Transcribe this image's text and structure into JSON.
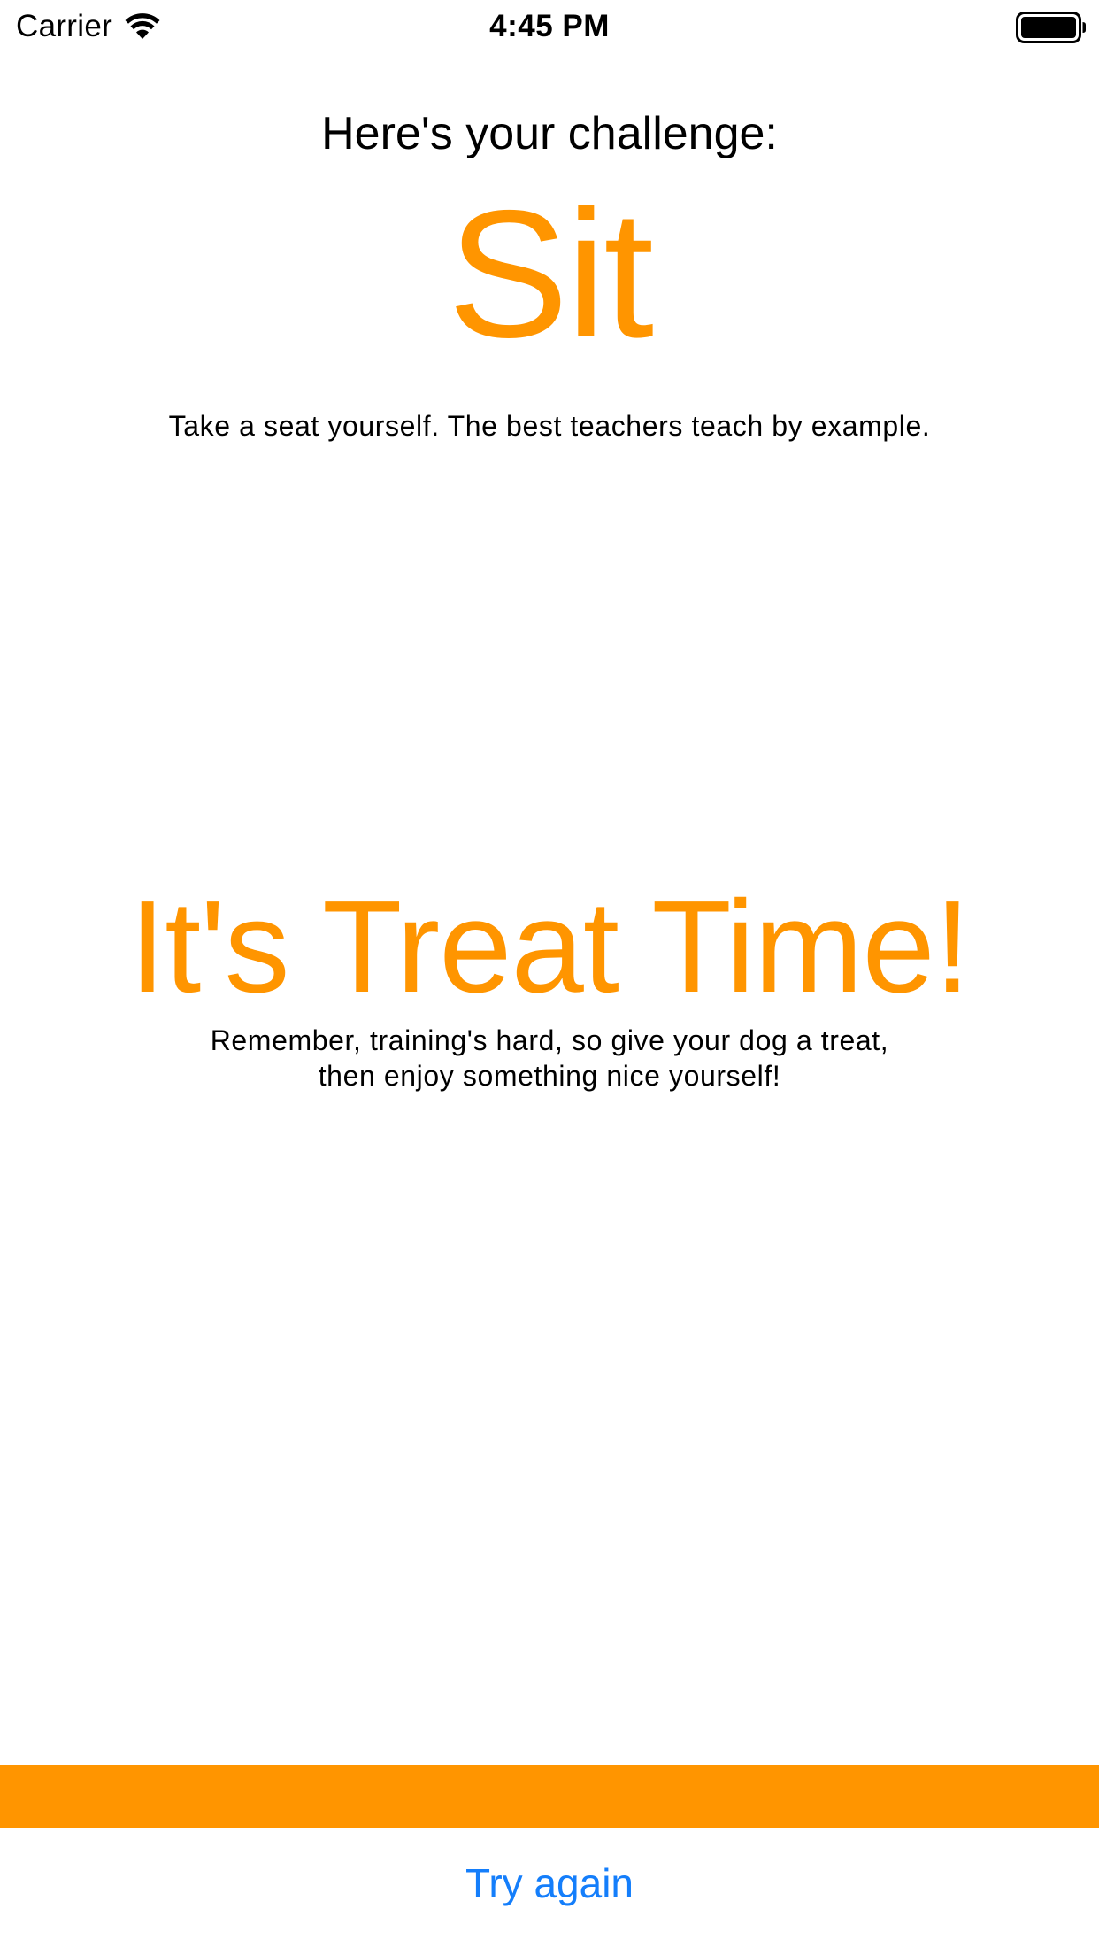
{
  "status_bar": {
    "carrier": "Carrier",
    "time": "4:45 PM",
    "wifi_icon": "wifi-icon",
    "battery_icon": "battery-full-icon"
  },
  "challenge": {
    "header": "Here's your challenge:",
    "command": "Sit",
    "description": "Take a seat yourself. The best teachers teach by example."
  },
  "treat": {
    "title": "It's Treat Time!",
    "description_line1": "Remember, training's hard, so give your dog a treat,",
    "description_line2": "then enjoy something nice yourself!"
  },
  "actions": {
    "try_again": "Try again"
  },
  "colors": {
    "accent": "#ff9500",
    "link": "#147efb",
    "text": "#000000",
    "background": "#ffffff"
  }
}
